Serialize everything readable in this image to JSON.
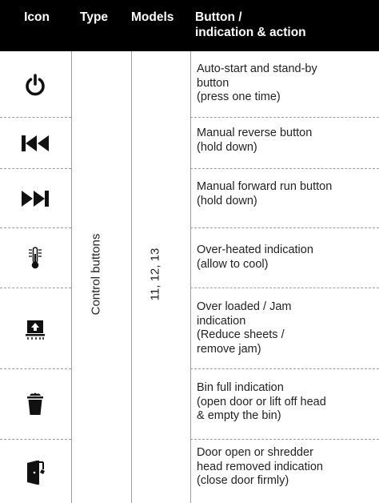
{
  "header": {
    "icon": "Icon",
    "type": "Type",
    "models": "Models",
    "button_line1": "Button /",
    "button_line2": "indication & action"
  },
  "type_value": "Control buttons",
  "models_value": "11, 12, 13",
  "rows": [
    {
      "icon": "power-icon",
      "lines": [
        "Auto-start and stand-by",
        "button",
        "(press one time)"
      ]
    },
    {
      "icon": "rewind-icon",
      "lines": [
        "Manual reverse button",
        "(hold down)"
      ]
    },
    {
      "icon": "forward-icon",
      "lines": [
        "Manual forward run button",
        "(hold down)"
      ]
    },
    {
      "icon": "thermometer-icon",
      "lines": [
        "Over-heated indication",
        "(allow to cool)"
      ]
    },
    {
      "icon": "paper-jam-icon",
      "lines": [
        "Over loaded / Jam",
        "indication",
        "(Reduce sheets /",
        "remove jam)"
      ]
    },
    {
      "icon": "bin-icon",
      "lines": [
        "Bin full indication",
        "(open door or lift off head",
        "& empty the bin)"
      ]
    },
    {
      "icon": "door-open-icon",
      "lines": [
        "Door open or shredder",
        "head removed indication",
        "(close door firmly)"
      ]
    }
  ],
  "colors": {
    "header_bg": "#000000",
    "header_text": "#ffffff",
    "rule": "#9c9c9c"
  }
}
